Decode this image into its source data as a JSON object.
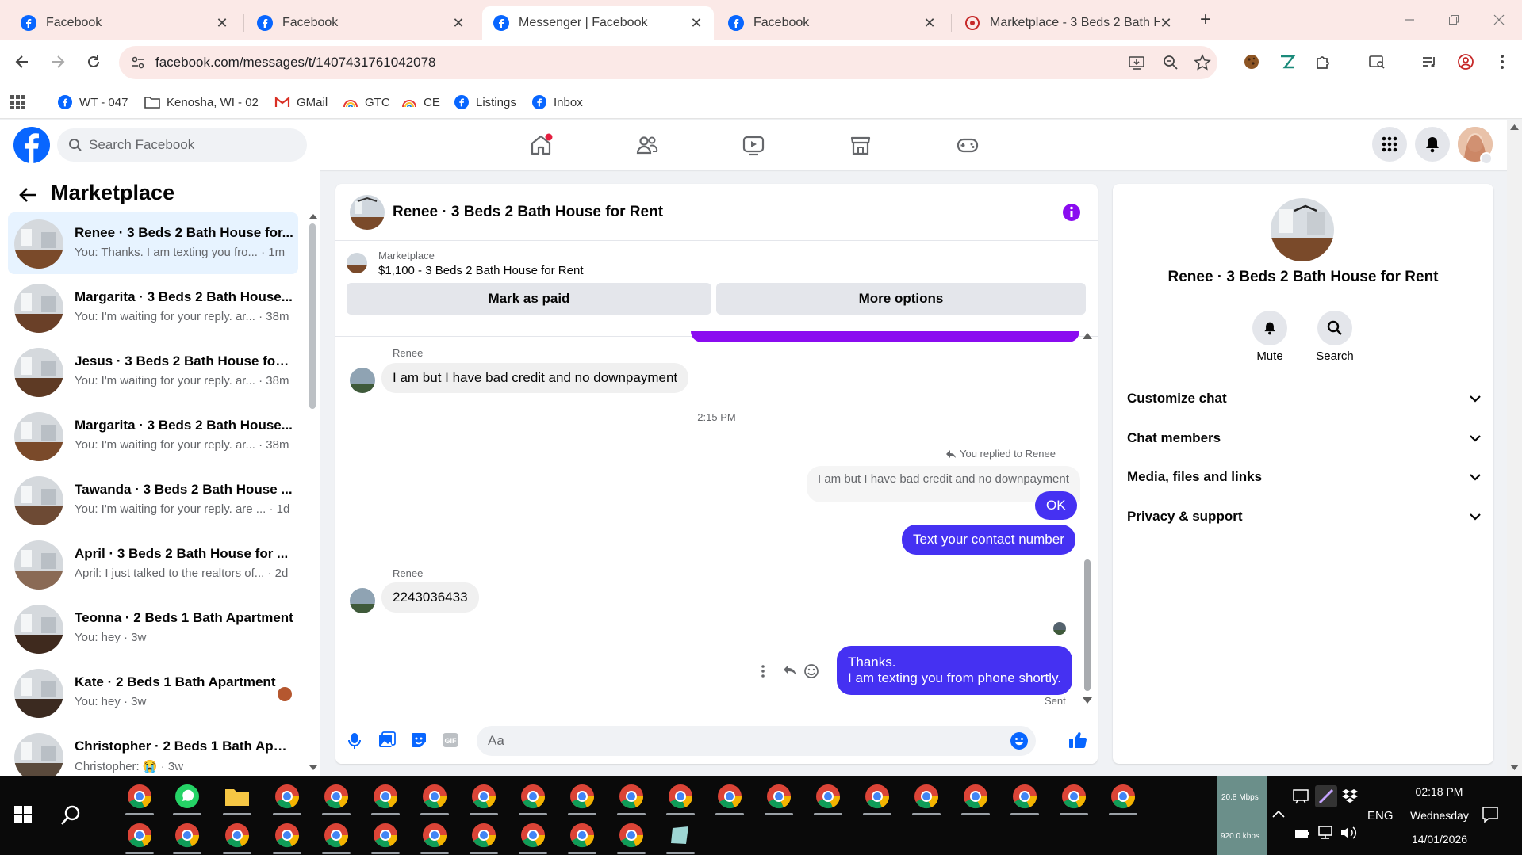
{
  "browser": {
    "tabs": [
      {
        "title": "Facebook",
        "active": false,
        "icon": "facebook-icon"
      },
      {
        "title": "Facebook",
        "active": false,
        "icon": "facebook-icon"
      },
      {
        "title": "Messenger | Facebook",
        "active": true,
        "icon": "facebook-icon"
      },
      {
        "title": "Facebook",
        "active": false,
        "icon": "facebook-icon"
      },
      {
        "title": "Marketplace - 3 Beds 2 Bath Ho",
        "active": false,
        "icon": "marketplace-icon"
      }
    ],
    "close_glyph": "✕",
    "new_tab_glyph": "+",
    "url": "facebook.com/messages/t/1407431761042078",
    "bookmarks": [
      {
        "label": "WT - 047",
        "icon": "facebook-icon"
      },
      {
        "label": "Kenosha, WI - 02",
        "icon": "folder-icon"
      },
      {
        "label": "GMail",
        "icon": "gmail-icon"
      },
      {
        "label": "GTC",
        "icon": "rainbow-icon"
      },
      {
        "label": "CE",
        "icon": "rainbow-icon"
      },
      {
        "label": "Listings",
        "icon": "facebook-icon"
      },
      {
        "label": "Inbox",
        "icon": "facebook-icon"
      }
    ]
  },
  "fb": {
    "search_placeholder": "Search Facebook",
    "accent": "#0866ff"
  },
  "sidebar": {
    "title": "Marketplace",
    "conversations": [
      {
        "name": "Renee · 3 Beds 2 Bath House for...",
        "preview": "You: Thanks. I am texting you fro...",
        "time": "· 1m",
        "active": true
      },
      {
        "name": "Margarita · 3 Beds 2 Bath House...",
        "preview": "You: I'm waiting for your reply. ar...",
        "time": "· 38m",
        "active": false
      },
      {
        "name": "Jesus · 3 Beds 2 Bath House for ...",
        "preview": "You: I'm waiting for your reply. ar...",
        "time": "· 38m",
        "active": false
      },
      {
        "name": "Margarita · 3 Beds 2 Bath House...",
        "preview": "You: I'm waiting for your reply. ar...",
        "time": "· 38m",
        "active": false
      },
      {
        "name": "Tawanda · 3 Beds 2 Bath House ...",
        "preview": "You: I'm waiting for your reply. are ...",
        "time": "· 1d",
        "active": false
      },
      {
        "name": "April · 3 Beds 2 Bath House for ...",
        "preview": "April: I just talked to the realtors of...",
        "time": "· 2d",
        "active": false
      },
      {
        "name": "Teonna · 2 Beds 1 Bath Apartment",
        "preview": "You: hey",
        "time": "· 3w",
        "active": false
      },
      {
        "name": "Kate · 2 Beds 1 Bath Apartment",
        "preview": "You: hey",
        "time": "· 3w",
        "active": false
      },
      {
        "name": "Christopher · 2 Beds 1 Bath Apar...",
        "preview": "Christopher: 😭",
        "time": "· 3w",
        "active": false
      }
    ]
  },
  "chat": {
    "title": "Renee · 3 Beds 2 Bath House for Rent",
    "listing_source": "Marketplace",
    "listing_title": "$1,100 - 3 Beds 2 Bath House for Rent",
    "mark_paid": "Mark as paid",
    "more_options": "More options",
    "sender_name": "Renee",
    "msg1": "I am but I have bad credit and no downpayment",
    "time_sep": "2:15 PM",
    "replied_label": "You replied to Renee",
    "quoted": "I am but I have bad credit and no downpayment",
    "msg_ok": "OK",
    "msg_contact": "Text your contact number",
    "sender_name2": "Renee",
    "msg_phone": "2243036433",
    "msg_thanks_1": "Thanks.",
    "msg_thanks_2": "I am texting you from phone shortly.",
    "status": "Sent",
    "input_placeholder": "Aa",
    "out_color": "#4531f2",
    "top_bar_color": "#8a0cf0"
  },
  "details": {
    "name": "Renee · 3 Beds 2 Bath House for Rent",
    "mute": "Mute",
    "search": "Search",
    "sections": [
      "Customize chat",
      "Chat members",
      "Media, files and links",
      "Privacy & support"
    ]
  },
  "taskbar": {
    "net_up": "20.8 Mbps",
    "net_down": "920.0 kbps",
    "lang": "ENG",
    "time": "02:18 PM",
    "day": "Wednesday",
    "date": "14/01/2026"
  }
}
